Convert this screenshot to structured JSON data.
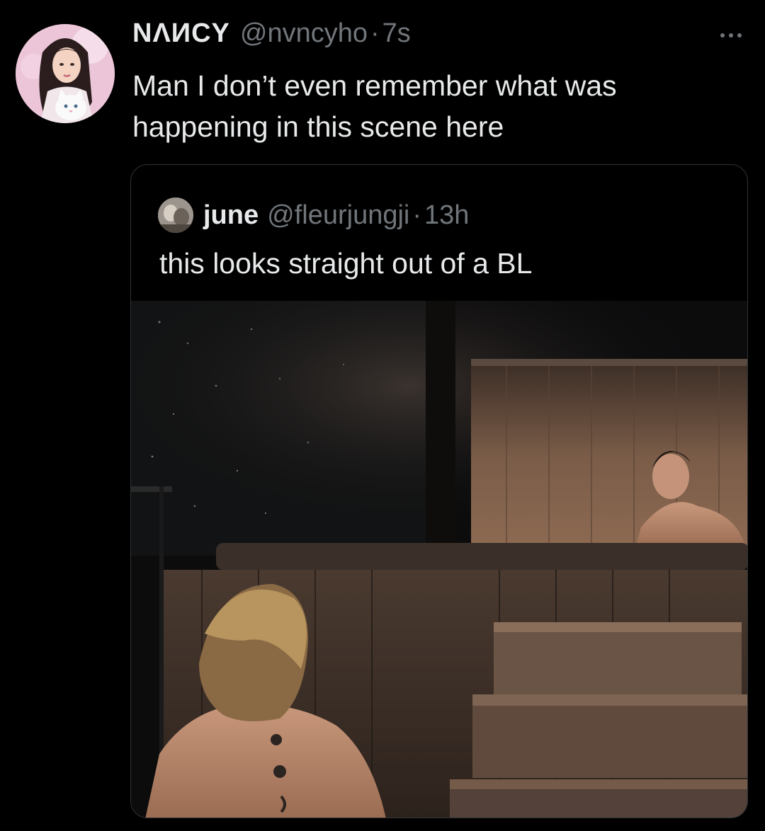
{
  "tweet": {
    "author": {
      "display_name": "NΛИCY",
      "handle": "@nvncyho",
      "separator": "·",
      "time": "7s",
      "avatar_icon": "avatar-anime-girl-with-cat"
    },
    "text": "Man I don’t even remember what was happening in this scene here",
    "more_icon": "more-horizontal-icon"
  },
  "quote": {
    "author": {
      "display_name": "june",
      "handle": "@fleurjungji",
      "separator": "·",
      "time": "13h",
      "avatar_icon": "avatar-photo"
    },
    "text": "this looks straight out of a BL",
    "media": {
      "type": "image",
      "subject": "hot-tub-scene"
    }
  },
  "colors": {
    "background": "#000000",
    "primary_text": "#e7e9ea",
    "secondary_text": "#71767b",
    "border": "#2f3336"
  }
}
